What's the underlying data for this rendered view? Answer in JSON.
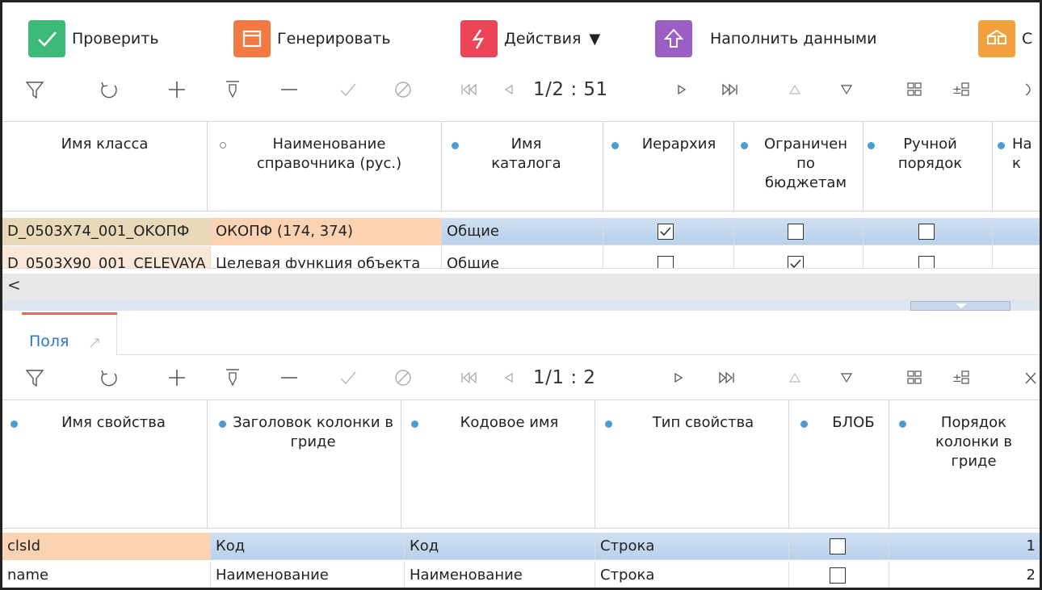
{
  "actions": {
    "check_label": "Проверить",
    "generate_label": "Генерировать",
    "actions_label": "Действия",
    "actions_arrow": "▼",
    "fill_label": "Наполнить данными",
    "cut_label": "С"
  },
  "colors": {
    "check": "#3dba78",
    "generate": "#f47a45",
    "actions": "#ec4557",
    "fill": "#9c5dc4",
    "last": "#f4a13d",
    "accent_tab": "#f06b3a",
    "selected_row": "#c4d8ef",
    "highlight_cell": "#fbd3b3",
    "dot": "#4a9bd6"
  },
  "top_toolbar": {
    "pager_text": "1/2 : 51"
  },
  "top_grid": {
    "columns": [
      "Имя класса",
      "Наименование справочника (рус.)",
      "Имя каталога",
      "Иерархия",
      "Ограничен по бюджетам",
      "Ручной порядок",
      "На к"
    ],
    "rows": [
      {
        "class": "D_0503X74_001_OKОПФ",
        "name": "ОКОПФ (174, 374)",
        "catalog": "Общие",
        "hierarchy": true,
        "budget": false,
        "manual": false
      },
      {
        "class": "D_0503X90_001_CELEVAYA",
        "name": "Целевая функция объекта",
        "catalog": "Общие",
        "hierarchy": false,
        "budget": true,
        "manual": false
      }
    ],
    "scroll_left": "<"
  },
  "bottom_panel": {
    "tab_label": "Поля",
    "pager_text": "1/1 : 2"
  },
  "bottom_grid": {
    "columns": [
      "Имя свойства",
      "Заголовок колонки в гриде",
      "Кодовое имя",
      "Тип свойства",
      "БЛОБ",
      "Порядок колонки в гриде"
    ],
    "rows": [
      {
        "name": "clsId",
        "caption": "Код",
        "code": "Код",
        "type": "Строка",
        "blob": false,
        "order": "1"
      },
      {
        "name": "name",
        "caption": "Наименование",
        "code": "Наименование",
        "type": "Строка",
        "blob": false,
        "order": "2"
      }
    ]
  }
}
